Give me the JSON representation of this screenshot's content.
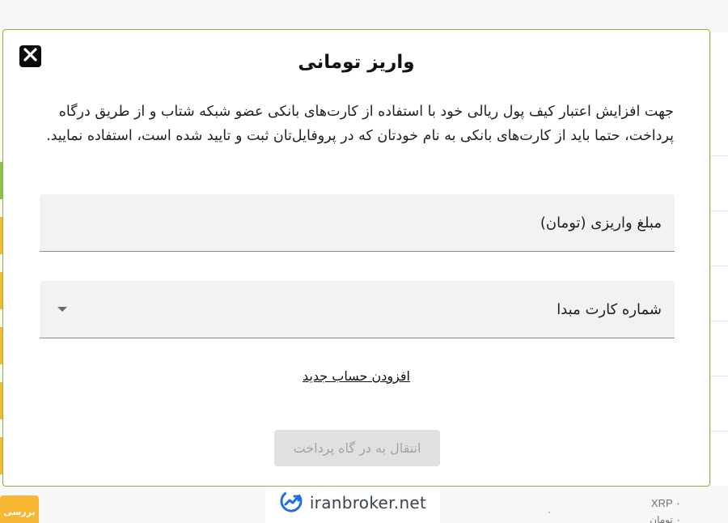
{
  "modal": {
    "title": "واریز تومانی",
    "description": "جهت افزایش اعتبار کیف پول ریالی خود با استفاده از کارت‌های بانکی عضو شبکه شتاب و از طریق درگاه پرداخت، حتما باید از کارت‌های بانکی به نام خودتان که در پروفایل‌تان ثبت و تایید شده است، استفاده نمایید.",
    "amount_field_label": "مبلغ واریزی (تومان)",
    "card_field_label": "شماره کارت مبدا",
    "add_account_link": "افزودن حساب جدید",
    "pay_button": "انتقال به در گاه پرداخت"
  },
  "background": {
    "review_button": "بررسی",
    "xrp_label": "XRP ۰",
    "toman_label": "۰ تومان",
    "zero_value": "۰"
  },
  "watermark": {
    "text": "iranbroker.net"
  },
  "colors": {
    "modal_border": "#8fb43a",
    "close_button_bg": "#0b0b0b",
    "field_bg": "#f2f2f2",
    "disabled_button_bg": "#e0e0e0",
    "review_button_bg": "#f7b733",
    "left_strip_green": "#8cc152",
    "left_strip_yellow": "#f7b733"
  },
  "icons": {
    "close": "close-x-icon",
    "dropdown": "caret-down-icon",
    "logo": "trend-chart-logo-icon"
  }
}
